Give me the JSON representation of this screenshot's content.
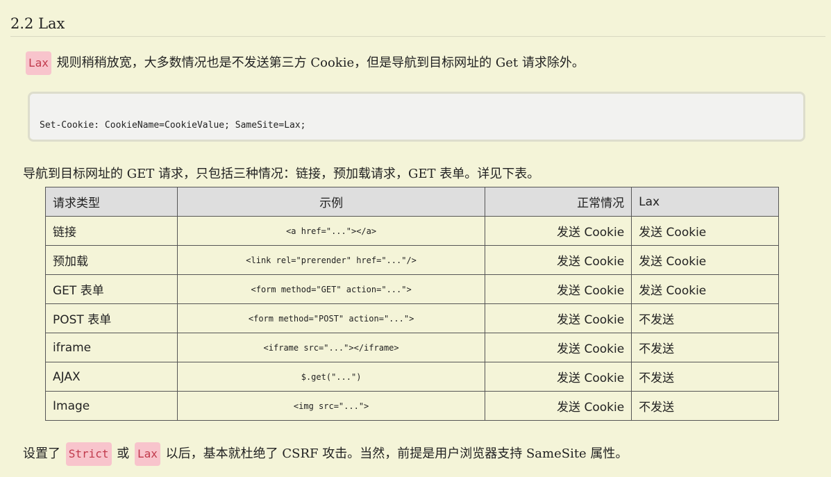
{
  "heading": "2.2 Lax",
  "intro": {
    "tag": "Lax",
    "text": "规则稍稍放宽，大多数情况也是不发送第三方 Cookie，但是导航到目标网址的 Get 请求除外。"
  },
  "code": "Set-Cookie: CookieName=CookieValue; SameSite=Lax;",
  "table_intro": "导航到目标网址的 GET 请求，只包括三种情况：链接，预加载请求，GET 表单。详见下表。",
  "table": {
    "headers": [
      "请求类型",
      "示例",
      "正常情况",
      "Lax"
    ],
    "rows": [
      [
        "链接",
        "<a href=\"...\"></a>",
        "发送 Cookie",
        "发送 Cookie"
      ],
      [
        "预加载",
        "<link rel=\"prerender\" href=\"...\"/>",
        "发送 Cookie",
        "发送 Cookie"
      ],
      [
        "GET 表单",
        "<form method=\"GET\" action=\"...\">",
        "发送 Cookie",
        "发送 Cookie"
      ],
      [
        "POST 表单",
        "<form method=\"POST\" action=\"...\">",
        "发送 Cookie",
        "不发送"
      ],
      [
        "iframe",
        "<iframe src=\"...\"></iframe>",
        "发送 Cookie",
        "不发送"
      ],
      [
        "AJAX",
        "$.get(\"...\")",
        "发送 Cookie",
        "不发送"
      ],
      [
        "Image",
        "<img src=\"...\">",
        "发送 Cookie",
        "不发送"
      ]
    ]
  },
  "footer": {
    "prefix": "设置了",
    "tag1": "Strict",
    "middle": "或",
    "tag2": "Lax",
    "suffix": "以后，基本就杜绝了 CSRF 攻击。当然，前提是用户浏览器支持 SameSite 属性。"
  }
}
